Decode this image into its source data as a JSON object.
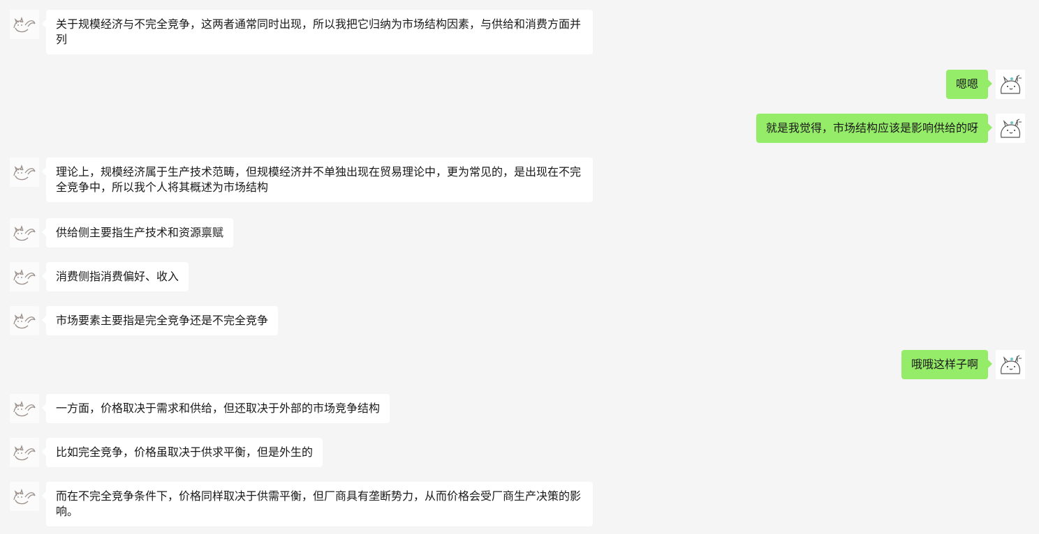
{
  "colors": {
    "background": "#f5f5f5",
    "incoming_bubble": "#ffffff",
    "outgoing_bubble": "#95ec69"
  },
  "messages": [
    {
      "side": "in",
      "avatar": "cat-avatar-icon",
      "text": "关于规模经济与不完全竞争，这两者通常同时出现，所以我把它归纳为市场结构因素，与供给和消费方面并列"
    },
    {
      "side": "out",
      "avatar": "mascot-avatar-icon",
      "text": "嗯嗯"
    },
    {
      "side": "out",
      "avatar": "mascot-avatar-icon",
      "text": "就是我觉得，市场结构应该是影响供给的呀"
    },
    {
      "side": "in",
      "avatar": "cat-avatar-icon",
      "text": "理论上，规模经济属于生产技术范畴，但规模经济并不单独出现在贸易理论中，更为常见的，是出现在不完全竞争中，所以我个人将其概述为市场结构"
    },
    {
      "side": "in",
      "avatar": "cat-avatar-icon",
      "text": "供给侧主要指生产技术和资源禀赋"
    },
    {
      "side": "in",
      "avatar": "cat-avatar-icon",
      "text": "消费侧指消费偏好、收入"
    },
    {
      "side": "in",
      "avatar": "cat-avatar-icon",
      "text": "市场要素主要指是完全竞争还是不完全竞争"
    },
    {
      "side": "out",
      "avatar": "mascot-avatar-icon",
      "text": "哦哦这样子啊"
    },
    {
      "side": "in",
      "avatar": "cat-avatar-icon",
      "text": "一方面，价格取决于需求和供给，但还取决于外部的市场竞争结构"
    },
    {
      "side": "in",
      "avatar": "cat-avatar-icon",
      "text": "比如完全竞争，价格虽取决于供求平衡，但是外生的"
    },
    {
      "side": "in",
      "avatar": "cat-avatar-icon",
      "text": "而在不完全竞争条件下，价格同样取决于供需平衡，但厂商具有垄断势力，从而价格会受厂商生产决策的影响。"
    }
  ]
}
